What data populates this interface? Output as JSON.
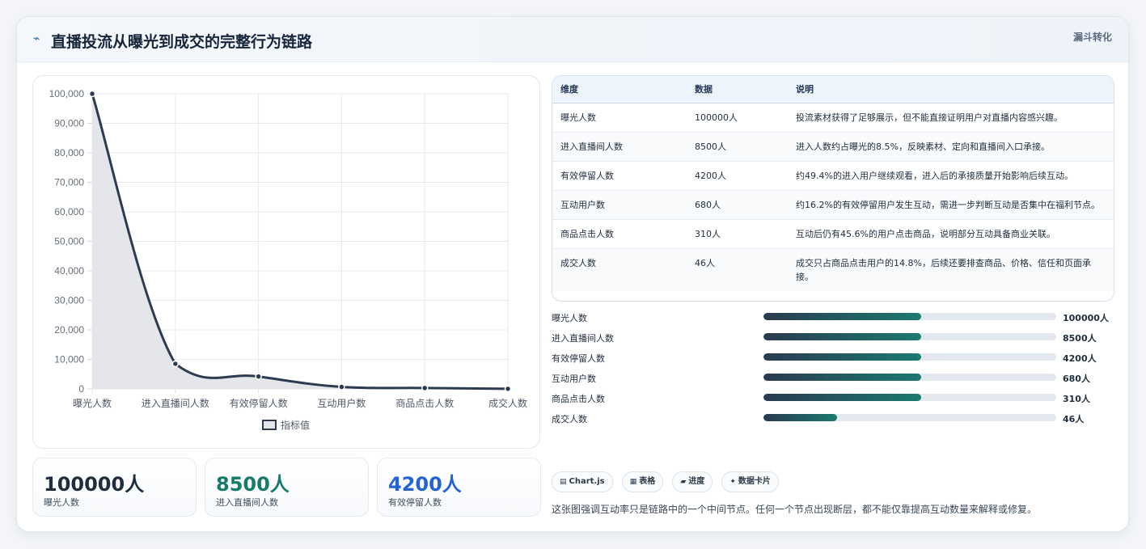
{
  "header": {
    "icon": "⌁",
    "title": "直播投流从曝光到成交的完整行为链路",
    "tag": "漏斗转化"
  },
  "chart_data": {
    "type": "area",
    "categories": [
      "曝光人数",
      "进入直播间人数",
      "有效停留人数",
      "互动用户数",
      "商品点击人数",
      "成交人数"
    ],
    "series": [
      {
        "name": "指标值",
        "values": [
          100000,
          8500,
          4200,
          680,
          310,
          46
        ]
      }
    ],
    "ylim": [
      0,
      100000
    ],
    "yticks": [
      "100,000",
      "90,000",
      "80,000",
      "70,000",
      "60,000",
      "50,000",
      "40,000",
      "30,000",
      "20,000",
      "10,000",
      "0"
    ],
    "grid": true,
    "legend": "bottom",
    "line_color": "#2d3b50",
    "fill_color": "#e4e6ea"
  },
  "kpis": [
    {
      "value": "100000人",
      "label": "曝光人数",
      "color": "#1f2d3d"
    },
    {
      "value": "8500人",
      "label": "进入直播间人数",
      "color": "#167b6b"
    },
    {
      "value": "4200人",
      "label": "有效停留人数",
      "color": "#2364d2"
    }
  ],
  "table": {
    "headers": [
      "维度",
      "数据",
      "说明"
    ],
    "rows": [
      [
        "曝光人数",
        "100000人",
        "投流素材获得了足够展示，但不能直接证明用户对直播内容感兴趣。"
      ],
      [
        "进入直播间人数",
        "8500人",
        "进入人数约占曝光的8.5%，反映素材、定向和直播间入口承接。"
      ],
      [
        "有效停留人数",
        "4200人",
        "约49.4%的进入用户继续观看，进入后的承接质量开始影响后续互动。"
      ],
      [
        "互动用户数",
        "680人",
        "约16.2%的有效停留用户发生互动，需进一步判断互动是否集中在福利节点。"
      ],
      [
        "商品点击人数",
        "310人",
        "互动后仍有45.6%的用户点击商品，说明部分互动具备商业关联。"
      ],
      [
        "成交人数",
        "46人",
        "成交只占商品点击用户的14.8%，后续还要排查商品、价格、信任和页面承接。"
      ]
    ]
  },
  "progress": [
    {
      "label": "曝光人数",
      "value": "100000人",
      "fraction": 0.54
    },
    {
      "label": "进入直播间人数",
      "value": "8500人",
      "fraction": 0.54
    },
    {
      "label": "有效停留人数",
      "value": "4200人",
      "fraction": 0.54
    },
    {
      "label": "互动用户数",
      "value": "680人",
      "fraction": 0.54
    },
    {
      "label": "商品点击人数",
      "value": "310人",
      "fraction": 0.54
    },
    {
      "label": "成交人数",
      "value": "46人",
      "fraction": 0.25
    }
  ],
  "chips": [
    {
      "icon": "▤",
      "label": "Chart.js"
    },
    {
      "icon": "▦",
      "label": "表格"
    },
    {
      "icon": "▰",
      "label": "进度"
    },
    {
      "icon": "✦",
      "label": "数据卡片"
    }
  ],
  "note": "这张图强调互动率只是链路中的一个中间节点。任何一个节点出现断层，都不能仅靠提高互动数量来解释或修复。"
}
